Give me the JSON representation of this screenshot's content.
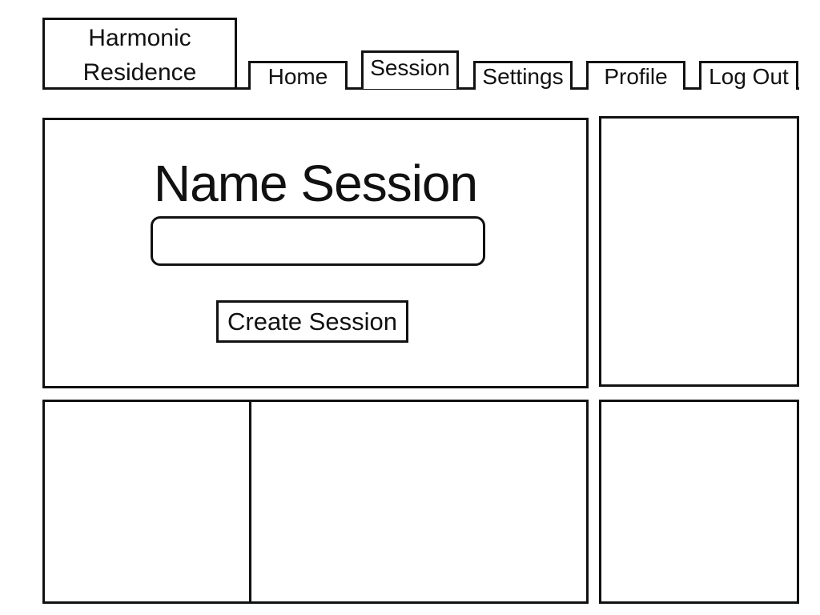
{
  "header": {
    "brand": "Harmonic\nResidence"
  },
  "nav": {
    "tabs": [
      {
        "label": "Home",
        "active": false
      },
      {
        "label": "Session",
        "active": true
      },
      {
        "label": "Settings",
        "active": false
      },
      {
        "label": "Profile",
        "active": false
      },
      {
        "label": "Log Out",
        "active": false
      }
    ]
  },
  "main": {
    "title": "Name Session",
    "session_name_value": "",
    "create_button_label": "Create Session"
  },
  "colors": {
    "stroke": "#111111",
    "background": "#ffffff"
  }
}
